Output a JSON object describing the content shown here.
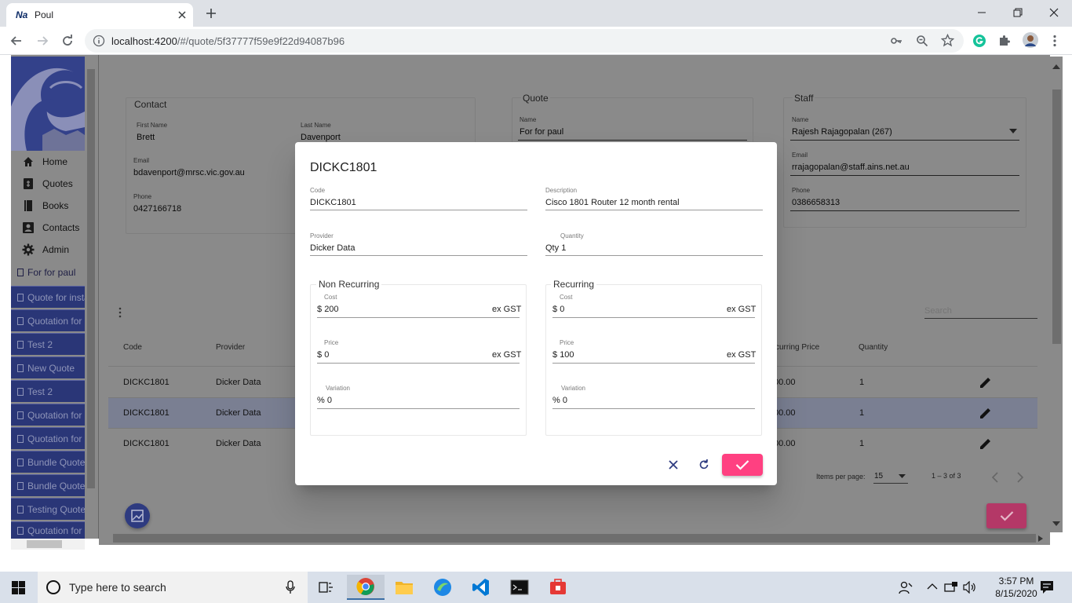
{
  "browser": {
    "tab_favicon": "Na",
    "tab_title": "Poul",
    "url_host": "localhost:4200",
    "url_path": "/#/quote/5f37777f59e9f22d94087b96"
  },
  "sidebar": {
    "nav": [
      {
        "label": "Home",
        "icon": "home-icon"
      },
      {
        "label": "Quotes",
        "icon": "quotes-icon"
      },
      {
        "label": "Books",
        "icon": "book-icon"
      },
      {
        "label": "Contacts",
        "icon": "contact-icon"
      },
      {
        "label": "Admin",
        "icon": "gear-icon"
      }
    ],
    "quotes": [
      "For for paul",
      "Quote for insta",
      "Quotation for c",
      "Test 2",
      "New Quote",
      "Test 2",
      "Quotation for c",
      "Quotation for c",
      "Bundle Quote",
      "Bundle Quote",
      "Testing Quote",
      "Quotation for c"
    ]
  },
  "contact": {
    "title": "Contact",
    "first_name_label": "First Name",
    "first_name": "Brett",
    "last_name_label": "Last Name",
    "last_name": "Davenport",
    "email_label": "Email",
    "email": "bdavenport@mrsc.vic.gov.au",
    "phone_label": "Phone",
    "phone": "0427166718"
  },
  "quote": {
    "title": "Quote",
    "name_label": "Name",
    "name": "For for paul"
  },
  "staff": {
    "title": "Staff",
    "name_label": "Name",
    "name": "Rajesh Rajagopalan (267)",
    "email_label": "Email",
    "email": "rrajagopalan@staff.ains.net.au",
    "phone_label": "Phone",
    "phone": "0386658313"
  },
  "table": {
    "search_placeholder": "Search",
    "headers": {
      "code": "Code",
      "provider": "Provider",
      "recurring_price": "curring Price",
      "quantity": "Quantity"
    },
    "rows": [
      {
        "code": "DICKC1801",
        "provider": "Dicker Data",
        "recurring_price": "00.00",
        "quantity": "1"
      },
      {
        "code": "DICKC1801",
        "provider": "Dicker Data",
        "recurring_price": "00.00",
        "quantity": "1"
      },
      {
        "code": "DICKC1801",
        "provider": "Dicker Data",
        "recurring_price": "00.00",
        "quantity": "1"
      }
    ],
    "items_per_page_label": "Items per page:",
    "items_per_page": "15",
    "range": "1 – 3 of 3"
  },
  "dialog": {
    "title": "DICKC1801",
    "code_label": "Code",
    "code": "DICKC1801",
    "description_label": "Description",
    "description": "Cisco 1801 Router 12 month rental",
    "provider_label": "Provider",
    "provider": "Dicker Data",
    "quantity_label": "Quantity",
    "quantity_prefix": "Qty",
    "quantity": "1",
    "non_recurring": {
      "legend": "Non Recurring",
      "cost_label": "Cost",
      "cost_prefix": "$",
      "cost": "200",
      "cost_suffix": "ex GST",
      "price_label": "Price",
      "price_prefix": "$",
      "price": "0",
      "price_suffix": "ex GST",
      "variation_label": "Variation",
      "variation_prefix": "%",
      "variation": "0"
    },
    "recurring": {
      "legend": "Recurring",
      "cost_label": "Cost",
      "cost_prefix": "$",
      "cost": "0",
      "cost_suffix": "ex GST",
      "price_label": "Price",
      "price_prefix": "$",
      "price": "100",
      "price_suffix": "ex GST",
      "variation_label": "Variation",
      "variation_prefix": "%",
      "variation": "0"
    }
  },
  "taskbar": {
    "search_text": "Type here to search",
    "time": "3:57 PM",
    "date": "8/15/2020"
  },
  "colors": {
    "accent": "#ff4081",
    "nav_primary": "#2a3677",
    "overlay": "#8a8a8a"
  }
}
